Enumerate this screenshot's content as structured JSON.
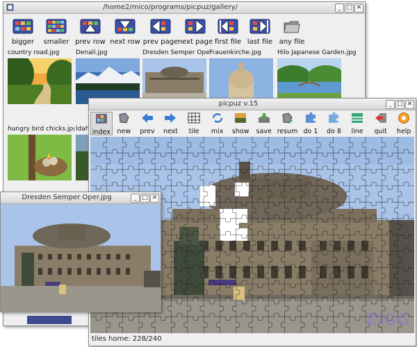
{
  "gallery": {
    "title": "/home2/mico/programs/picpuz/gallery/",
    "toolbar": [
      {
        "label": "bigger",
        "icon": "bigger-thumbnails-icon"
      },
      {
        "label": "smaller",
        "icon": "smaller-thumbnails-icon"
      },
      {
        "label": "prev row",
        "icon": "prev-row-icon"
      },
      {
        "label": "next row",
        "icon": "next-row-icon"
      },
      {
        "label": "prev page",
        "icon": "prev-page-icon"
      },
      {
        "label": "next page",
        "icon": "next-page-icon"
      },
      {
        "label": "first file",
        "icon": "first-file-icon"
      },
      {
        "label": "last file",
        "icon": "last-file-icon"
      },
      {
        "label": "any file",
        "icon": "folder-icon"
      }
    ],
    "thumbnails_row1": [
      "country road.jpg",
      "Denali.jpg",
      "Dresden Semper Oper.jp",
      "Frauenkirche.jpg",
      "Hilo Japanese Garden.jpg"
    ],
    "thumbnails_row2": [
      "hungry bird chicks.jpg",
      "Idaho"
    ]
  },
  "puzzle": {
    "title": "picpuz v.15",
    "toolbar": [
      {
        "label": "index",
        "icon": "index-grid-icon",
        "active": true
      },
      {
        "label": "new",
        "icon": "new-puzzle-icon"
      },
      {
        "label": "prev",
        "icon": "arrow-left-icon"
      },
      {
        "label": "next",
        "icon": "arrow-right-icon"
      },
      {
        "label": "tile",
        "icon": "tile-grid-icon"
      },
      {
        "label": "mix",
        "icon": "mix-icon"
      },
      {
        "label": "show",
        "icon": "show-image-icon"
      },
      {
        "label": "save",
        "icon": "save-icon"
      },
      {
        "label": "resum",
        "icon": "resume-icon"
      },
      {
        "label": "do 1",
        "icon": "do-one-icon"
      },
      {
        "label": "do 8",
        "icon": "do-eight-icon"
      },
      {
        "label": "line",
        "icon": "line-icon"
      },
      {
        "label": "quit",
        "icon": "quit-icon"
      },
      {
        "label": "help",
        "icon": "help-icon"
      }
    ],
    "status": "tiles home: 228/240"
  },
  "preview": {
    "title": "Dresden Semper Oper.jpg"
  },
  "colors": {
    "titlebar": "#d9d9d9",
    "window_bg": "#efefef",
    "sky": "#a9c4e8",
    "stone": "#8a7d68"
  }
}
